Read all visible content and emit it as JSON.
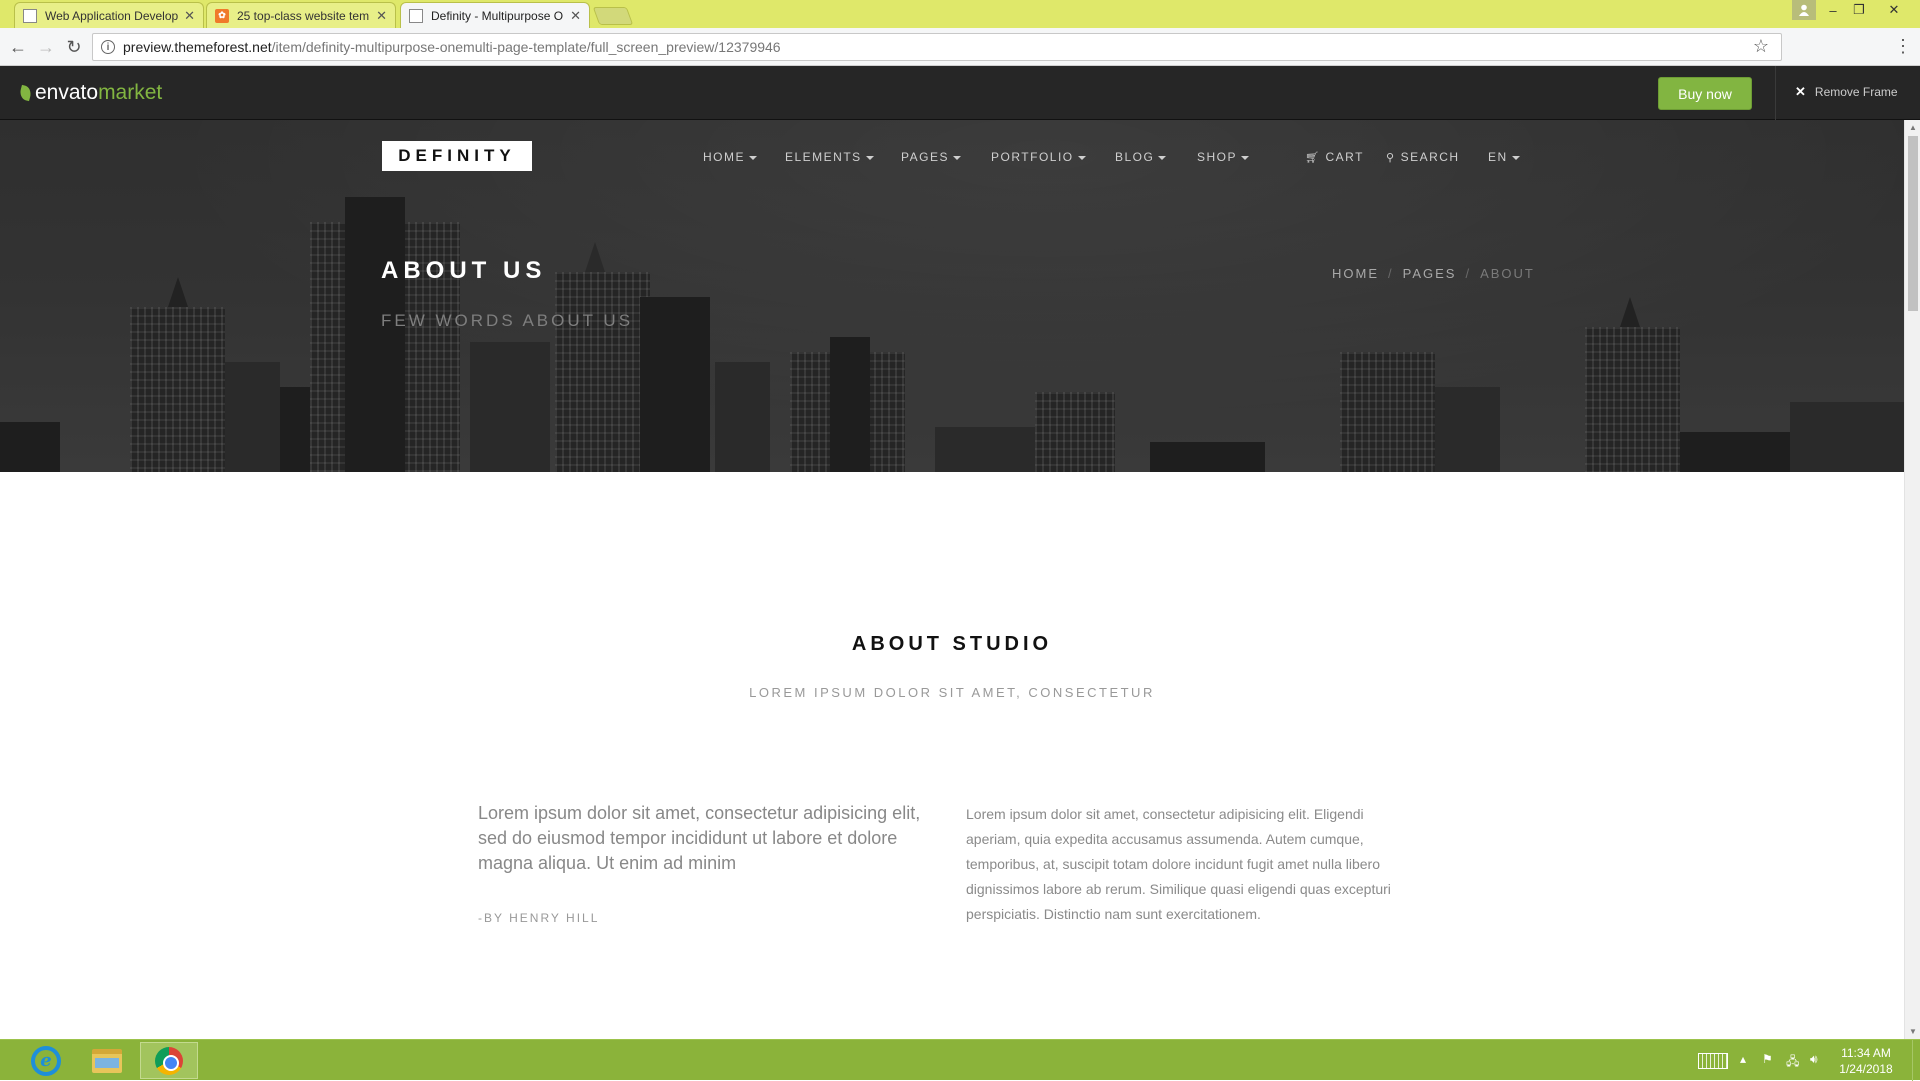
{
  "browser": {
    "tabs": [
      {
        "title": "Web Application Develop",
        "favicon": "document-icon",
        "active": false
      },
      {
        "title": "25 top-class website tem",
        "favicon": "orange-site-icon",
        "active": false
      },
      {
        "title": "Definity - Multipurpose O",
        "favicon": "document-icon",
        "active": true
      }
    ],
    "tab_close": "✕",
    "url_host": "preview.themeforest.net",
    "url_path": "/item/definity-multipurpose-onemulti-page-template/full_screen_preview/12379946",
    "window_controls": {
      "minimize": "–",
      "maximize": "❐",
      "close": "✕"
    },
    "colors": {
      "tabstrip": "#dfe86a"
    }
  },
  "envato_bar": {
    "logo_part1": "envato",
    "logo_part2": "market",
    "buy_now": "Buy now",
    "remove_frame": "Remove Frame",
    "colors": {
      "accent": "#82b541",
      "background": "#262626"
    }
  },
  "site": {
    "logo": "DEFINITY",
    "nav": [
      {
        "label": "HOME",
        "dropdown": true
      },
      {
        "label": "ELEMENTS",
        "dropdown": true
      },
      {
        "label": "PAGES",
        "dropdown": true
      },
      {
        "label": "PORTFOLIO",
        "dropdown": true
      },
      {
        "label": "BLOG",
        "dropdown": true
      },
      {
        "label": "SHOP",
        "dropdown": true
      }
    ],
    "cart": "CART",
    "search": "SEARCH",
    "language": "EN",
    "hero": {
      "title": "ABOUT US",
      "subtitle": "FEW WORDS ABOUT US",
      "breadcrumbs": [
        "HOME",
        "PAGES",
        "ABOUT"
      ],
      "breadcrumb_separator": "/"
    },
    "section": {
      "title": "ABOUT STUDIO",
      "subtitle": "LOREM IPSUM DOLOR SIT AMET, CONSECTETUR",
      "quote": "Lorem ipsum dolor sit amet, consectetur adipisicing elit, sed do eiusmod tempor incididunt ut labore et dolore magna aliqua. Ut enim ad minim",
      "author": "-BY HENRY HILL",
      "body": "Lorem ipsum dolor sit amet, consectetur adipisicing elit. Eligendi aperiam, quia expedita accusamus assumenda. Autem cumque, temporibus, at, suscipit totam dolore incidunt fugit amet nulla libero dignissimos labore ab rerum. Similique quasi eligendi quas excepturi perspiciatis. Distinctio nam sunt exercitationem."
    }
  },
  "taskbar": {
    "apps": [
      "internet-explorer-icon",
      "file-explorer-icon",
      "chrome-icon"
    ],
    "active_app": "chrome-icon",
    "clock_time": "11:34 AM",
    "clock_date": "1/24/2018",
    "colors": {
      "background": "#8bb33a"
    }
  }
}
